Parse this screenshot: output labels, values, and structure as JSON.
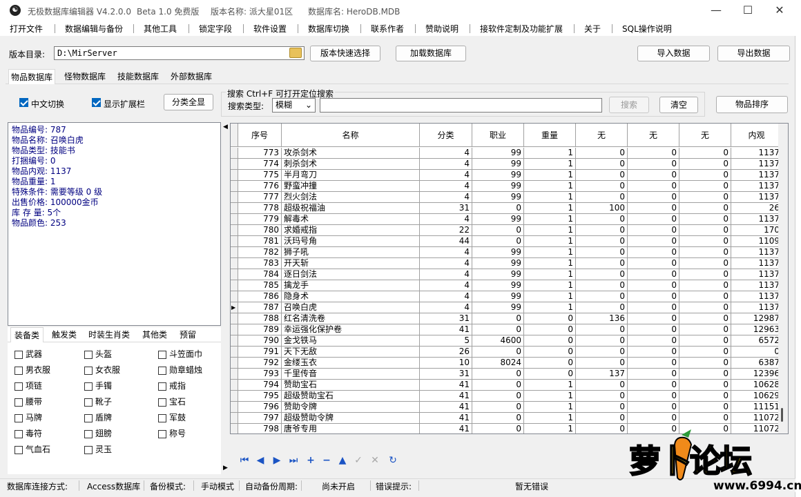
{
  "title": {
    "app": "无极数据库编辑器 V4.2.0.0",
    "edition": "Beta 1.0 免费版",
    "version_name": "版本名称: 派大星01区",
    "db_name": "数据库名: HeroDB.MDB"
  },
  "menu": [
    "打开文件",
    "数据编辑与备份",
    "其他工具",
    "锁定字段",
    "软件设置",
    "数据库切换",
    "联系作者",
    "赞助说明",
    "接软件定制及功能扩展",
    "关于",
    "SQL操作说明"
  ],
  "toolbar": {
    "dir_label": "版本目录:",
    "dir_value": "D:\\MirServer",
    "quick_select": "版本快速选择",
    "load_db": "加载数据库",
    "import": "导入数据",
    "export": "导出数据"
  },
  "tabs": [
    "物品数据库",
    "怪物数据库",
    "技能数据库",
    "外部数据库"
  ],
  "options": {
    "chinese": "中文切换",
    "extend": "显示扩展栏",
    "show_all": "分类全显",
    "search_title": "搜索  Ctrl+F 可打开定位搜索",
    "search_type_label": "搜索类型:",
    "search_type_value": "模糊",
    "search_btn": "搜索",
    "clear_btn": "清空",
    "sort_btn": "物品排序"
  },
  "info": [
    "物品编号: 787",
    "物品名称: 召唤白虎",
    "物品类型: 技能书",
    "打捆编号: 0",
    "物品内观: 1137",
    "物品重量: 1",
    "特殊条件: 需要等级 0 级",
    "出售价格: 100000金币",
    "库 存 量: 5个",
    "物品颜色: 253"
  ],
  "category_tabs": [
    "装备类",
    "触发类",
    "时装生肖类",
    "其他类",
    "预留"
  ],
  "categories": [
    "武器",
    "头盔",
    "斗笠面巾",
    "男衣服",
    "女衣服",
    "勋章蜡烛",
    "项链",
    "手镯",
    "戒指",
    "腰带",
    "靴子",
    "宝石",
    "马牌",
    "盾牌",
    "军鼓",
    "毒符",
    "翅膀",
    "称号",
    "气血石",
    "灵玉"
  ],
  "grid": {
    "headers": [
      "序号",
      "名称",
      "分类",
      "职业",
      "重量",
      "无",
      "无",
      "无",
      "内观"
    ],
    "rows": [
      [
        "773",
        "攻杀剑术",
        "4",
        "99",
        "1",
        "0",
        "0",
        "0",
        "1137"
      ],
      [
        "774",
        "刺杀剑术",
        "4",
        "99",
        "1",
        "0",
        "0",
        "0",
        "1137"
      ],
      [
        "775",
        "半月弯刀",
        "4",
        "99",
        "1",
        "0",
        "0",
        "0",
        "1137"
      ],
      [
        "776",
        "野蛮冲撞",
        "4",
        "99",
        "1",
        "0",
        "0",
        "0",
        "1137"
      ],
      [
        "777",
        "烈火剑法",
        "4",
        "99",
        "1",
        "0",
        "0",
        "0",
        "1137"
      ],
      [
        "778",
        "超级祝福油",
        "31",
        "0",
        "1",
        "100",
        "0",
        "0",
        "26"
      ],
      [
        "779",
        "解毒术",
        "4",
        "99",
        "1",
        "0",
        "0",
        "0",
        "1137"
      ],
      [
        "780",
        "求婚戒指",
        "22",
        "0",
        "1",
        "0",
        "0",
        "0",
        "170"
      ],
      [
        "781",
        "沃玛号角",
        "44",
        "0",
        "1",
        "0",
        "0",
        "0",
        "1109"
      ],
      [
        "782",
        "狮子吼",
        "4",
        "99",
        "1",
        "0",
        "0",
        "0",
        "1137"
      ],
      [
        "783",
        "开天斩",
        "4",
        "99",
        "1",
        "0",
        "0",
        "0",
        "1137"
      ],
      [
        "784",
        "逐日剑法",
        "4",
        "99",
        "1",
        "0",
        "0",
        "0",
        "1137"
      ],
      [
        "785",
        "擒龙手",
        "4",
        "99",
        "1",
        "0",
        "0",
        "0",
        "1137"
      ],
      [
        "786",
        "隐身术",
        "4",
        "99",
        "1",
        "0",
        "0",
        "0",
        "1137"
      ],
      [
        "787",
        "召唤白虎",
        "4",
        "99",
        "1",
        "0",
        "0",
        "0",
        "1137"
      ],
      [
        "788",
        "红名清洗卷",
        "31",
        "0",
        "0",
        "136",
        "0",
        "0",
        "12987"
      ],
      [
        "789",
        "幸运强化保护卷",
        "41",
        "0",
        "0",
        "0",
        "0",
        "0",
        "12963"
      ],
      [
        "790",
        "金戈铁马",
        "5",
        "4600",
        "0",
        "0",
        "0",
        "0",
        "6572"
      ],
      [
        "791",
        "天下无敌",
        "26",
        "0",
        "0",
        "0",
        "0",
        "0",
        "0"
      ],
      [
        "792",
        "金缕玉衣",
        "10",
        "8024",
        "0",
        "0",
        "0",
        "0",
        "6387"
      ],
      [
        "793",
        "千里传音",
        "31",
        "0",
        "0",
        "137",
        "0",
        "0",
        "12396"
      ],
      [
        "794",
        "赞助宝石",
        "41",
        "0",
        "1",
        "0",
        "0",
        "0",
        "10628"
      ],
      [
        "795",
        "超级赞助宝石",
        "41",
        "0",
        "1",
        "0",
        "0",
        "0",
        "10629"
      ],
      [
        "796",
        "赞助令牌",
        "41",
        "0",
        "1",
        "0",
        "0",
        "0",
        "11151"
      ],
      [
        "797",
        "超级赞助令牌",
        "41",
        "0",
        "1",
        "0",
        "0",
        "0",
        "11072"
      ],
      [
        "798",
        "唐爷专用",
        "41",
        "0",
        "1",
        "0",
        "0",
        "0",
        "11072"
      ]
    ],
    "current_row": "787"
  },
  "status": {
    "conn_label": "数据库连接方式:",
    "conn_value": "Access数据库",
    "backup_label": "备份模式:",
    "backup_value": "手动模式",
    "auto_label": "自动备份周期:",
    "auto_value": "尚未开启",
    "error_label": "错误提示:",
    "error_value": "暂无错误"
  },
  "watermark": {
    "logo": "萝卜论坛",
    "url": "www.6994.cn"
  },
  "colors": {
    "info_text": "#000080",
    "accent": "#0067c0",
    "nav": "#1b54c4"
  }
}
